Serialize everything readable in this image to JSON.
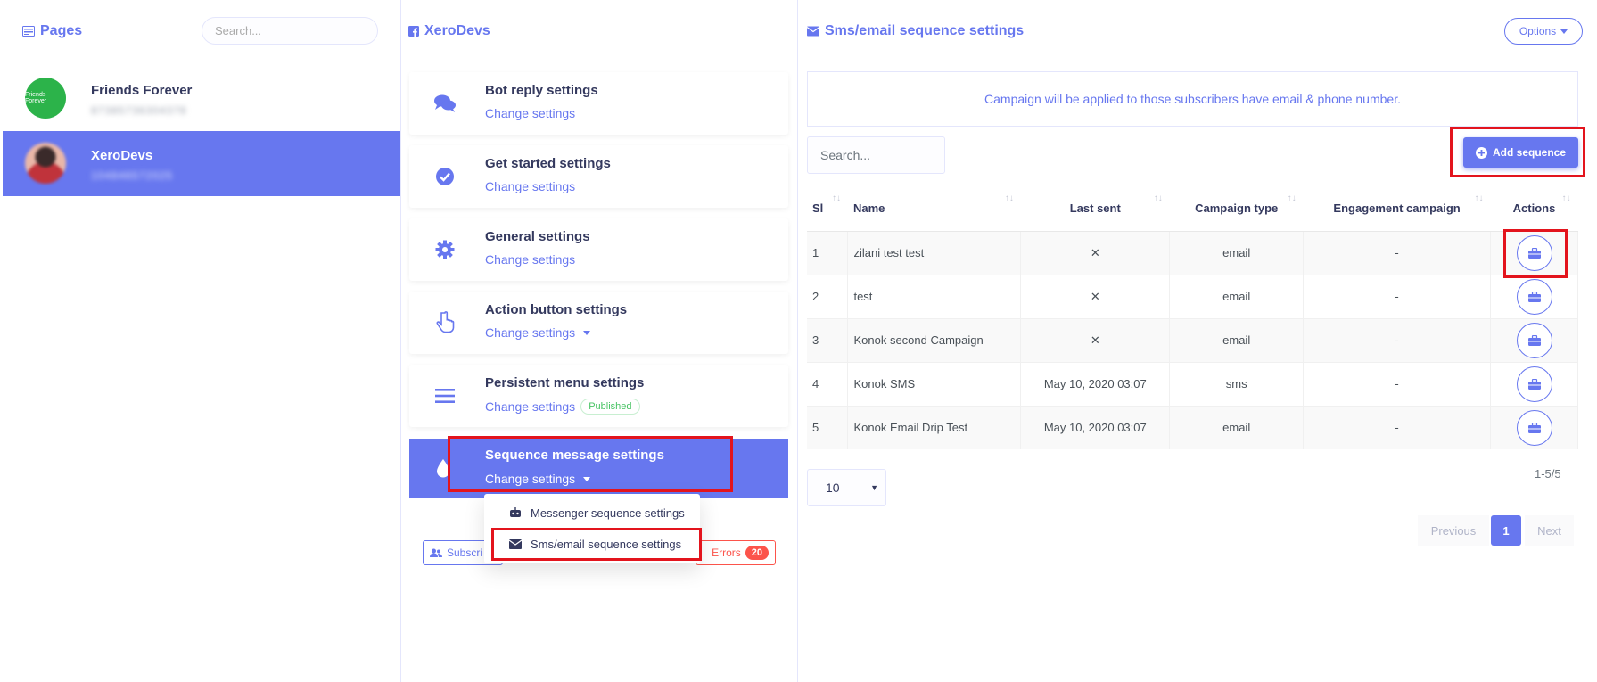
{
  "colors": {
    "accent": "#6777ef",
    "danger": "#fc544b",
    "success": "#47c363",
    "highlight": "#e3141d"
  },
  "pages_panel": {
    "title": "Pages",
    "search_placeholder": "Search...",
    "items": [
      {
        "name": "Friends Forever",
        "page_id": "87385736304378",
        "avatar_text": "Friends Forever",
        "active": false
      },
      {
        "name": "XeroDevs",
        "page_id": "104846572025",
        "avatar_text": "",
        "active": true
      }
    ]
  },
  "settings_panel": {
    "title": "XeroDevs",
    "cards": [
      {
        "title": "Bot reply settings",
        "link": "Change settings",
        "icon": "comments-icon"
      },
      {
        "title": "Get started settings",
        "link": "Change settings",
        "icon": "check-circle-icon"
      },
      {
        "title": "General settings",
        "link": "Change settings",
        "icon": "gear-icon"
      },
      {
        "title": "Action button settings",
        "link": "Change settings",
        "icon": "hand-pointer-icon"
      },
      {
        "title": "Persistent menu settings",
        "link": "Change settings",
        "badge": "Published",
        "icon": "bars-icon"
      },
      {
        "title": "Sequence message settings",
        "link": "Change settings",
        "icon": "drop-icon"
      }
    ],
    "dropdown": [
      {
        "label": "Messenger sequence settings",
        "icon": "robot-icon"
      },
      {
        "label": "Sms/email sequence settings",
        "icon": "envelope-icon"
      }
    ],
    "subscribers_label": "Subscri",
    "errors_label": "Errors",
    "errors_count": "20"
  },
  "sequence_panel": {
    "title": "Sms/email sequence settings",
    "options_label": "Options",
    "notice": "Campaign will be applied to those subscribers have email & phone number.",
    "search_placeholder": "Search...",
    "add_button": "Add sequence",
    "columns": [
      "Sl",
      "Name",
      "Last sent",
      "Campaign type",
      "Engagement campaign",
      "Actions"
    ],
    "rows": [
      {
        "sl": "1",
        "name": "zilani test test",
        "last_sent": "✕",
        "type": "email",
        "engagement": "-"
      },
      {
        "sl": "2",
        "name": "test",
        "last_sent": "✕",
        "type": "email",
        "engagement": "-"
      },
      {
        "sl": "3",
        "name": "Konok second Campaign",
        "last_sent": "✕",
        "type": "email",
        "engagement": "-"
      },
      {
        "sl": "4",
        "name": "Konok SMS",
        "last_sent": "May 10, 2020 03:07",
        "type": "sms",
        "engagement": "-"
      },
      {
        "sl": "5",
        "name": "Konok Email Drip Test",
        "last_sent": "May 10, 2020 03:07",
        "type": "email",
        "engagement": "-"
      }
    ],
    "page_length": "10",
    "info": "1-5/5",
    "pagination": {
      "previous": "Previous",
      "current": "1",
      "next": "Next"
    }
  }
}
